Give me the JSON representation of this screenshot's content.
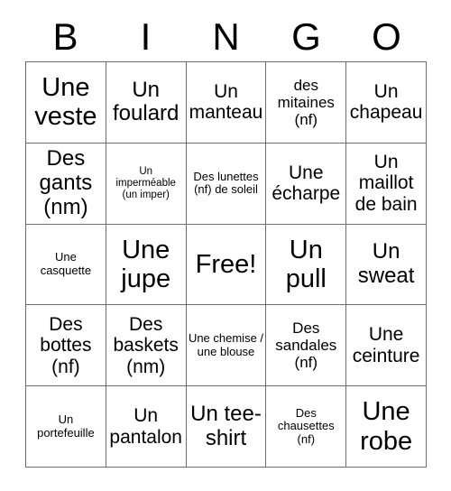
{
  "card": {
    "title": "BINGO Card",
    "header_letters": [
      "B",
      "I",
      "N",
      "G",
      "O"
    ],
    "free_space_label": "Free!",
    "colors": {
      "text": "#000000",
      "border": "#6e6e6e",
      "background": "#ffffff"
    },
    "rows": [
      [
        {
          "text": "Une veste",
          "size": "fs-xl"
        },
        {
          "text": "Un foulard",
          "size": "fs-lg"
        },
        {
          "text": "Un manteau",
          "size": "fs-md"
        },
        {
          "text": "des mitaines (nf)",
          "size": "fs-sm"
        },
        {
          "text": "Un chapeau",
          "size": "fs-md"
        }
      ],
      [
        {
          "text": "Des gants (nm)",
          "size": "fs-lg"
        },
        {
          "text": "Un imperméable (un imper)",
          "size": "fs-xxs"
        },
        {
          "text": "Des lunettes (nf) de soleil",
          "size": "fs-xs"
        },
        {
          "text": "Une écharpe",
          "size": "fs-md"
        },
        {
          "text": "Un maillot de bain",
          "size": "fs-md"
        }
      ],
      [
        {
          "text": "Une casquette",
          "size": "fs-xs"
        },
        {
          "text": "Une jupe",
          "size": "fs-xl"
        },
        {
          "text": "Free!",
          "size": "fs-xl"
        },
        {
          "text": "Un pull",
          "size": "fs-xl"
        },
        {
          "text": "Un sweat",
          "size": "fs-lg"
        }
      ],
      [
        {
          "text": "Des bottes (nf)",
          "size": "fs-md"
        },
        {
          "text": "Des baskets (nm)",
          "size": "fs-md"
        },
        {
          "text": "Une chemise / une blouse",
          "size": "fs-xs"
        },
        {
          "text": "Des sandales (nf)",
          "size": "fs-sm"
        },
        {
          "text": "Une ceinture",
          "size": "fs-md"
        }
      ],
      [
        {
          "text": "Un portefeuille",
          "size": "fs-xs"
        },
        {
          "text": "Un pantalon",
          "size": "fs-md"
        },
        {
          "text": "Un tee-shirt",
          "size": "fs-lg"
        },
        {
          "text": "Des chausettes (nf)",
          "size": "fs-xs"
        },
        {
          "text": "Une robe",
          "size": "fs-xl"
        }
      ]
    ]
  }
}
